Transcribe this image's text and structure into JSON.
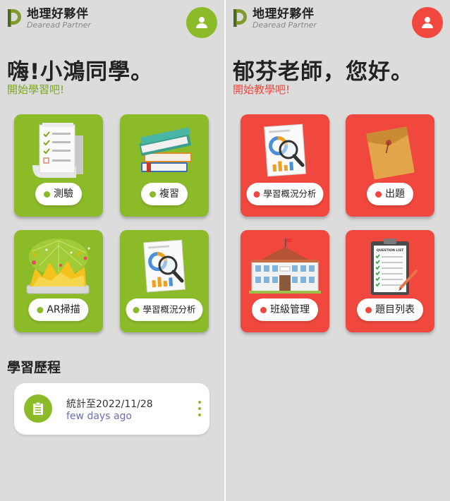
{
  "colors": {
    "student_accent": "#8cbb29",
    "teacher_accent": "#f0483e",
    "background": "#dcdcdc",
    "history_date_color": "#6a6fb0"
  },
  "student": {
    "logo": {
      "title": "地理好夥伴",
      "subtitle": "Dearead Partner",
      "icon": "logo-mark"
    },
    "avatar_icon": "user-icon",
    "greeting": "嗨!小鴻同學。",
    "subgreeting": "開始學習吧!",
    "cards": [
      {
        "label": "測驗",
        "icon": "quiz-checklist-icon"
      },
      {
        "label": "複習",
        "icon": "books-icon"
      },
      {
        "label": "AR掃描",
        "icon": "ar-scan-icon"
      },
      {
        "label": "學習概況分析",
        "icon": "analysis-magnifier-icon"
      }
    ],
    "section_title": "學習歷程",
    "history": {
      "icon": "clipboard-icon",
      "line1": "統計至2022/11/28",
      "line2": "few days ago",
      "menu_icon": "kebab-menu-icon"
    }
  },
  "teacher": {
    "logo": {
      "title": "地理好夥伴",
      "subtitle": "Dearead Partner",
      "icon": "logo-mark"
    },
    "avatar_icon": "user-icon",
    "greeting": "郁芬老師，您好。",
    "subgreeting": "開始教學吧!",
    "cards": [
      {
        "label": "學習概況分析",
        "icon": "analysis-magnifier-icon"
      },
      {
        "label": "出題",
        "icon": "envelope-icon"
      },
      {
        "label": "班級管理",
        "icon": "school-building-icon"
      },
      {
        "label": "題目列表",
        "icon": "question-list-icon",
        "illustration_text": "QUESTION LIST"
      }
    ]
  }
}
